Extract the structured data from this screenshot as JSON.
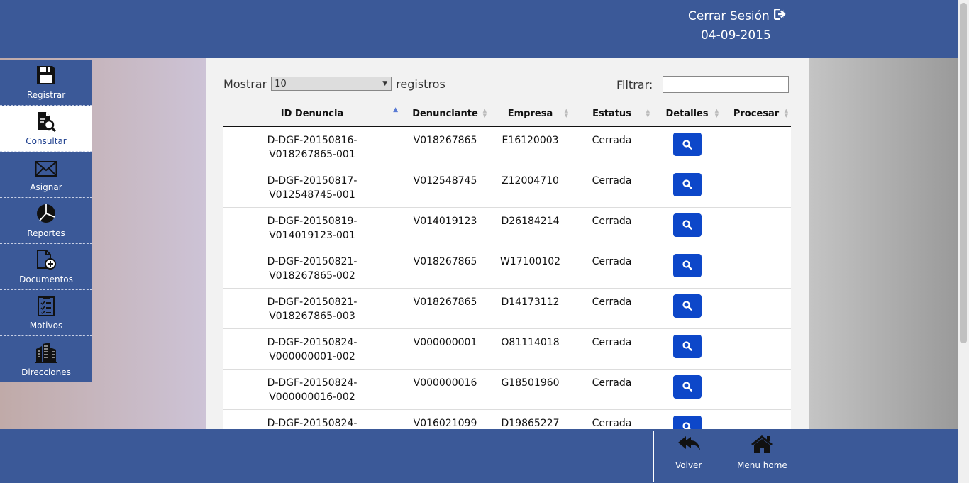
{
  "header": {
    "logout_label": "Cerrar Sesión",
    "date": "04-09-2015"
  },
  "sidebar": {
    "items": [
      {
        "label": "Registrar",
        "icon": "save-icon"
      },
      {
        "label": "Consultar",
        "icon": "document-search-icon",
        "active": true
      },
      {
        "label": "Asignar",
        "icon": "envelope-icon"
      },
      {
        "label": "Reportes",
        "icon": "pie-chart-icon"
      },
      {
        "label": "Documentos",
        "icon": "document-add-icon"
      },
      {
        "label": "Motivos",
        "icon": "clipboard-list-icon"
      },
      {
        "label": "Direcciones",
        "icon": "buildings-icon"
      }
    ]
  },
  "controls": {
    "show_label": "Mostrar",
    "page_size": "10",
    "records_label": "registros",
    "filter_label": "Filtrar:",
    "filter_value": ""
  },
  "table": {
    "columns": [
      "ID Denuncia",
      "Denunciante",
      "Empresa",
      "Estatus",
      "Detalles",
      "Procesar"
    ],
    "rows": [
      {
        "id1": "D-DGF-20150816-",
        "id2": "V018267865-001",
        "denunciante": "V018267865",
        "empresa": "E16120003",
        "estatus": "Cerrada"
      },
      {
        "id1": "D-DGF-20150817-",
        "id2": "V012548745-001",
        "denunciante": "V012548745",
        "empresa": "Z12004710",
        "estatus": "Cerrada"
      },
      {
        "id1": "D-DGF-20150819-",
        "id2": "V014019123-001",
        "denunciante": "V014019123",
        "empresa": "D26184214",
        "estatus": "Cerrada"
      },
      {
        "id1": "D-DGF-20150821-",
        "id2": "V018267865-002",
        "denunciante": "V018267865",
        "empresa": "W17100102",
        "estatus": "Cerrada"
      },
      {
        "id1": "D-DGF-20150821-",
        "id2": "V018267865-003",
        "denunciante": "V018267865",
        "empresa": "D14173112",
        "estatus": "Cerrada"
      },
      {
        "id1": "D-DGF-20150824-",
        "id2": "V000000001-002",
        "denunciante": "V000000001",
        "empresa": "O81114018",
        "estatus": "Cerrada"
      },
      {
        "id1": "D-DGF-20150824-",
        "id2": "V000000016-002",
        "denunciante": "V000000016",
        "empresa": "G18501960",
        "estatus": "Cerrada"
      },
      {
        "id1": "D-DGF-20150824-",
        "id2": "",
        "denunciante": "V016021099",
        "empresa": "D19865227",
        "estatus": "Cerrada"
      }
    ]
  },
  "footer": {
    "back_label": "Volver",
    "home_label": "Menu home"
  },
  "colors": {
    "brand": "#3b5998",
    "detail_button": "#0d47c9"
  }
}
